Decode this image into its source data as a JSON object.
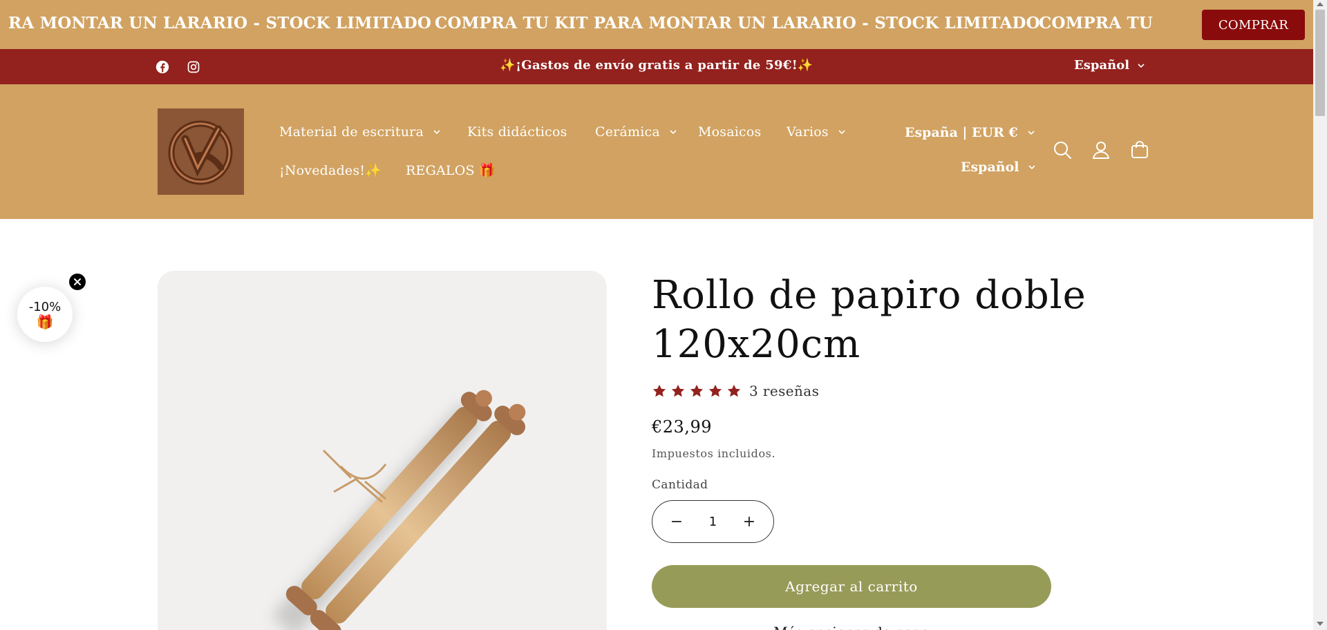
{
  "marquee": {
    "items": [
      "RA MONTAR UN LARARIO  - STOCK LIMITADO",
      "COMPRA TU KIT PARA MONTAR UN LARARIO  - STOCK LIMITADO",
      "COMPRA TU KIT"
    ],
    "button_label": "COMPRAR"
  },
  "announcement": {
    "text": "✨¡Gastos de envío gratis a partir de 59€!✨",
    "language": "Español",
    "social": [
      "facebook-icon",
      "instagram-icon"
    ]
  },
  "header": {
    "logo_alt": "logo",
    "nav": [
      {
        "label": "Material de escritura",
        "has_dropdown": true
      },
      {
        "label": "Kits didácticos",
        "has_dropdown": false
      },
      {
        "label": "Cerámica",
        "has_dropdown": true
      },
      {
        "label": "Mosaicos",
        "has_dropdown": false
      },
      {
        "label": "Varios",
        "has_dropdown": true
      },
      {
        "label": "¡Novedades!✨",
        "has_dropdown": false
      },
      {
        "label": "REGALOS 🎁",
        "has_dropdown": false
      }
    ],
    "country": "España | EUR €",
    "language": "Español",
    "icons": [
      "search-icon",
      "account-icon",
      "cart-icon"
    ]
  },
  "discount": {
    "percent": "-10%",
    "gift": "🎁"
  },
  "product": {
    "title": "Rollo de papiro doble 120x20cm",
    "rating": 5,
    "reviews": "3 reseñas",
    "price": "€23,99",
    "tax_note": "Impuestos incluidos.",
    "quantity_label": "Cantidad",
    "quantity": "1",
    "add_to_cart": "Agregar al carrito",
    "more_payment": "Más opciones de pago"
  },
  "colors": {
    "header_bg": "#d1a261",
    "announcement_bg": "#93211d",
    "buy_button": "#8a0b0b",
    "cart_button": "#979b58",
    "star": "#93211d"
  }
}
